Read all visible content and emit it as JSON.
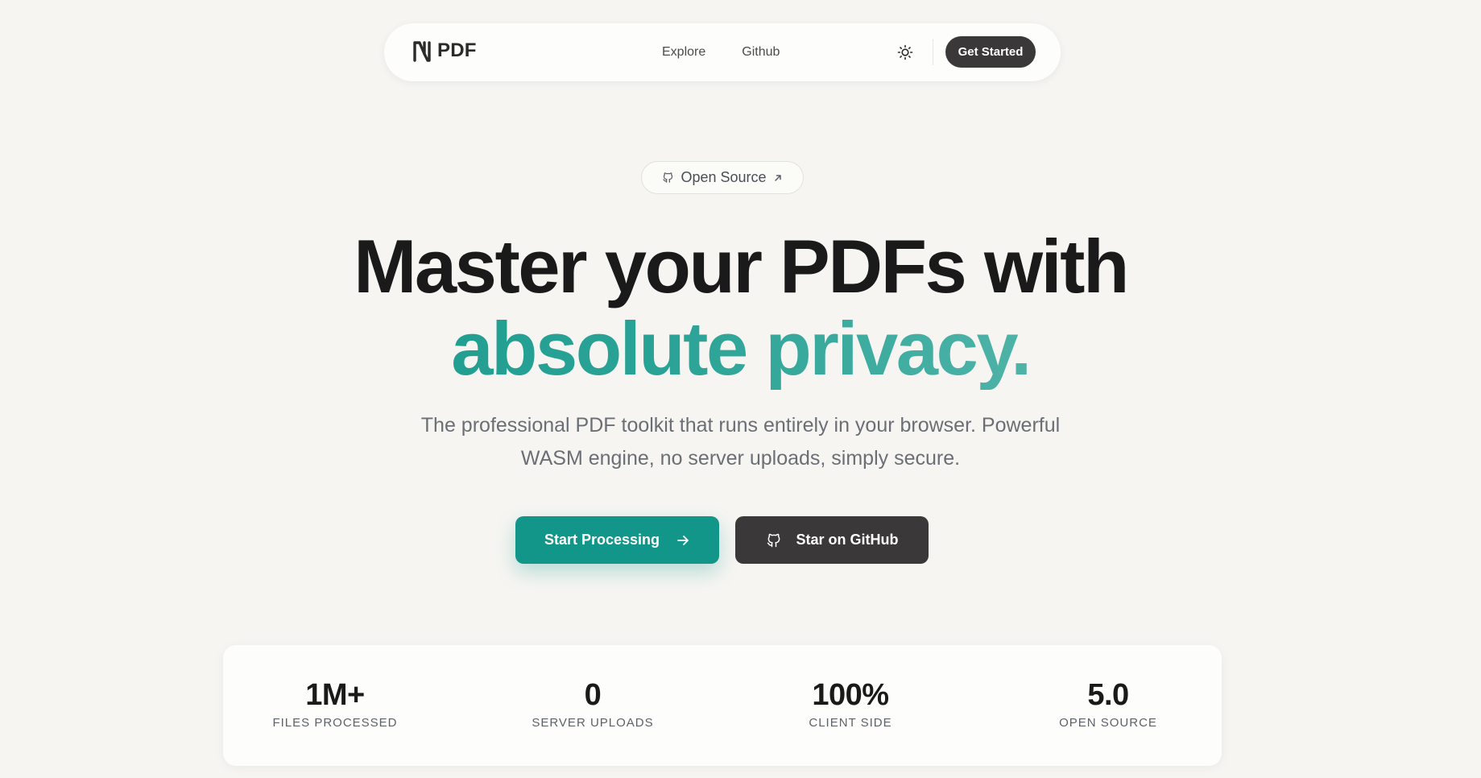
{
  "nav": {
    "brand": "PDF",
    "links": [
      "Explore",
      "Github"
    ],
    "cta": "Get Started"
  },
  "badge": {
    "label": "Open Source"
  },
  "hero": {
    "title_line1": "Master your PDFs with",
    "title_line2": "absolute privacy.",
    "subtitle_line1": "The professional PDF toolkit that runs entirely in your browser. Powerful",
    "subtitle_line2": "WASM engine, no server uploads, simply secure."
  },
  "actions": {
    "primary": "Start Processing",
    "secondary": "Star on GitHub"
  },
  "stats": [
    {
      "value": "1M+",
      "label": "FILES PROCESSED"
    },
    {
      "value": "0",
      "label": "SERVER UPLOADS"
    },
    {
      "value": "100%",
      "label": "CLIENT SIDE"
    },
    {
      "value": "5.0",
      "label": "OPEN SOURCE"
    }
  ],
  "colors": {
    "background": "#f6f5f2",
    "accent": "#13968a",
    "dark_button": "#3a3838"
  },
  "icons": [
    "logo-icon",
    "sun-icon",
    "github-icon",
    "arrow-up-right-icon",
    "arrow-right-icon"
  ]
}
